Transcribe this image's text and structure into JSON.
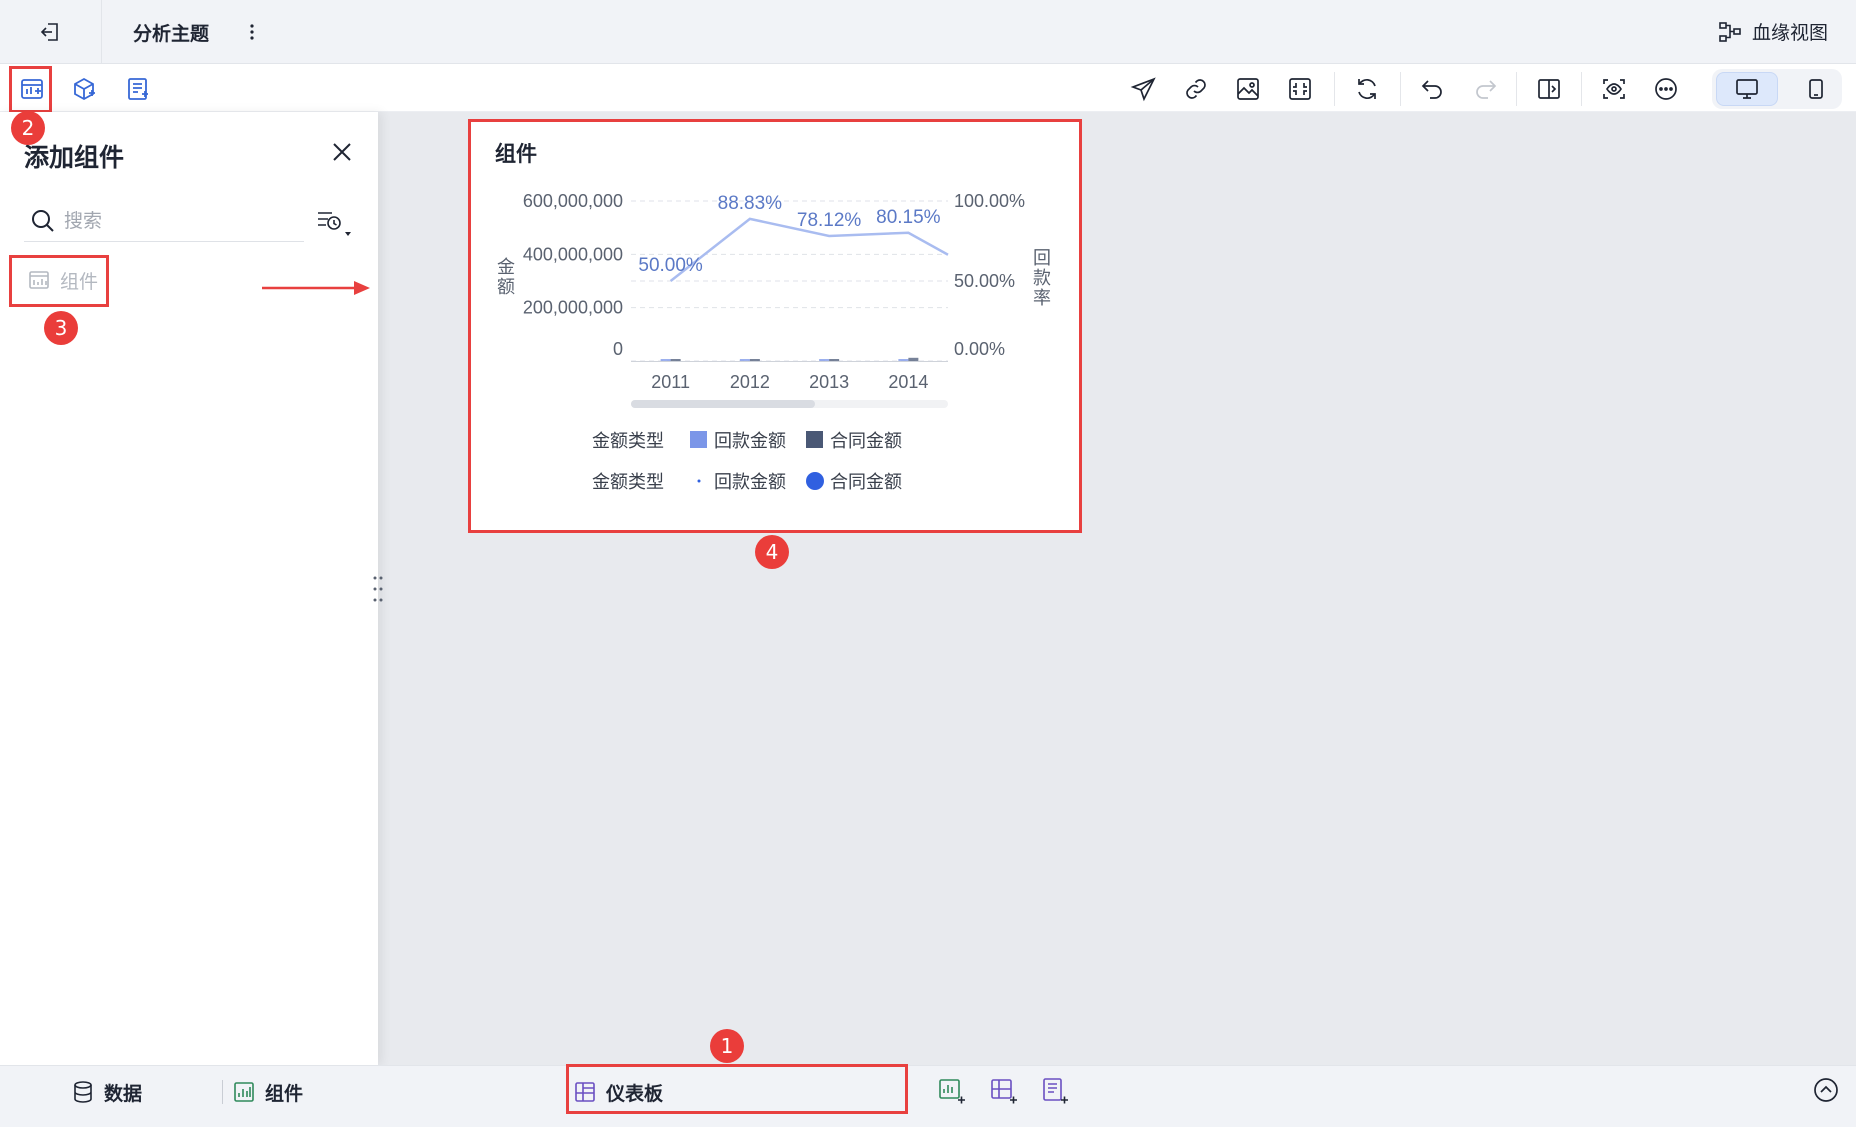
{
  "header": {
    "title": "分析主题",
    "lineage_label": "血缘视图"
  },
  "panel": {
    "title": "添加组件",
    "search_placeholder": "搜索",
    "item_label": "组件"
  },
  "card": {
    "title": "组件"
  },
  "annotations": {
    "b1": "1",
    "b2": "2",
    "b3": "3",
    "b4": "4"
  },
  "bottom": {
    "data_label": "数据",
    "component_label": "组件",
    "dashboard_label": "仪表板"
  },
  "colors": {
    "accent": "#3768d6",
    "annotation_red": "#e8403f",
    "bar_refund": "#7b96e8",
    "bar_contract": "#4a5875",
    "line_rate": "#a9bcf0",
    "dot_contract": "#3060e0"
  },
  "chart_data": {
    "type": "bar",
    "categories": [
      "2011",
      "2012",
      "2013",
      "2014"
    ],
    "ylabel": "金额",
    "y2label": "回款率",
    "y_ticks": [
      "600,000,000",
      "400,000,000",
      "200,000,000",
      "0"
    ],
    "y2_ticks": [
      "100.00%",
      "50.00%",
      "0.00%"
    ],
    "ylim": [
      0,
      600000000
    ],
    "y2lim": [
      0,
      100
    ],
    "series": [
      {
        "name": "回款金额",
        "kind": "bar",
        "values": [
          1500000,
          1800000,
          1600000,
          6000000
        ]
      },
      {
        "name": "合同金额",
        "kind": "bar",
        "values": [
          3000000,
          2000000,
          2000000,
          12000000
        ]
      },
      {
        "name": "回款率",
        "kind": "line",
        "axis": "right",
        "values": [
          50.0,
          88.83,
          78.12,
          80.15
        ],
        "labels": [
          "50.00%",
          "88.83%",
          "78.12%",
          "80.15%"
        ]
      }
    ],
    "legend": [
      {
        "group": "金额类型",
        "items": [
          "回款金额",
          "合同金额"
        ]
      },
      {
        "group": "金额类型",
        "items": [
          "回款金额",
          "合同金额"
        ]
      }
    ]
  }
}
